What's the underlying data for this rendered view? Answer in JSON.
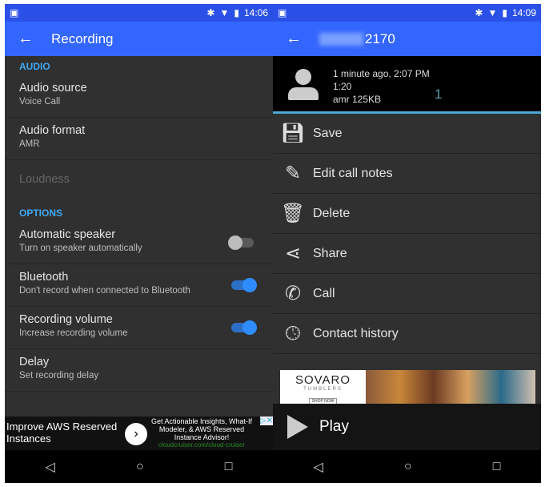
{
  "left": {
    "status": {
      "time": "14:06"
    },
    "toolbar": {
      "title": "Recording"
    },
    "sections": [
      {
        "header": "AUDIO",
        "items": [
          {
            "title": "Audio source",
            "subtitle": "Voice Call"
          },
          {
            "title": "Audio format",
            "subtitle": "AMR"
          },
          {
            "title": "Loudness",
            "disabled": true
          }
        ]
      },
      {
        "header": "OPTIONS",
        "items": [
          {
            "title": "Automatic speaker",
            "subtitle": "Turn on speaker automatically",
            "toggle": false
          },
          {
            "title": "Bluetooth",
            "subtitle": "Don't record when connected to Bluetooth",
            "toggle": true
          },
          {
            "title": "Recording volume",
            "subtitle": "Increase recording volume",
            "toggle": true
          },
          {
            "title": "Delay",
            "subtitle": "Set recording delay"
          }
        ]
      }
    ],
    "ad": {
      "headline": "Improve AWS Reserved Instances",
      "body": "Get Actionable Insights, What-If Modeler, & AWS Reserved Instance Advisor!",
      "url": "cloudcruiser.com/cloud-cruiser"
    }
  },
  "right": {
    "status": {
      "time": "14:09"
    },
    "toolbar": {
      "title": "2170"
    },
    "call": {
      "when": "1 minute ago, 2:07 PM",
      "duration": "1:20",
      "format": "amr 125KB",
      "count": "1"
    },
    "menu": [
      {
        "label": "Save",
        "icon": "floppy-disk-icon"
      },
      {
        "label": "Edit call notes",
        "icon": "pencil-icon"
      },
      {
        "label": "Delete",
        "icon": "trash-icon"
      },
      {
        "label": "Share",
        "icon": "share-icon"
      },
      {
        "label": "Call",
        "icon": "phone-icon"
      },
      {
        "label": "Contact history",
        "icon": "clock-icon"
      }
    ],
    "ad": {
      "brand": "SOVARO",
      "sub": "TUMBLERS",
      "cta": "SHOP NOW"
    },
    "play": {
      "label": "Play"
    }
  },
  "colors": {
    "status": "#2b50e8",
    "toolbar": "#3366ff",
    "accent": "#3fa9f5"
  }
}
